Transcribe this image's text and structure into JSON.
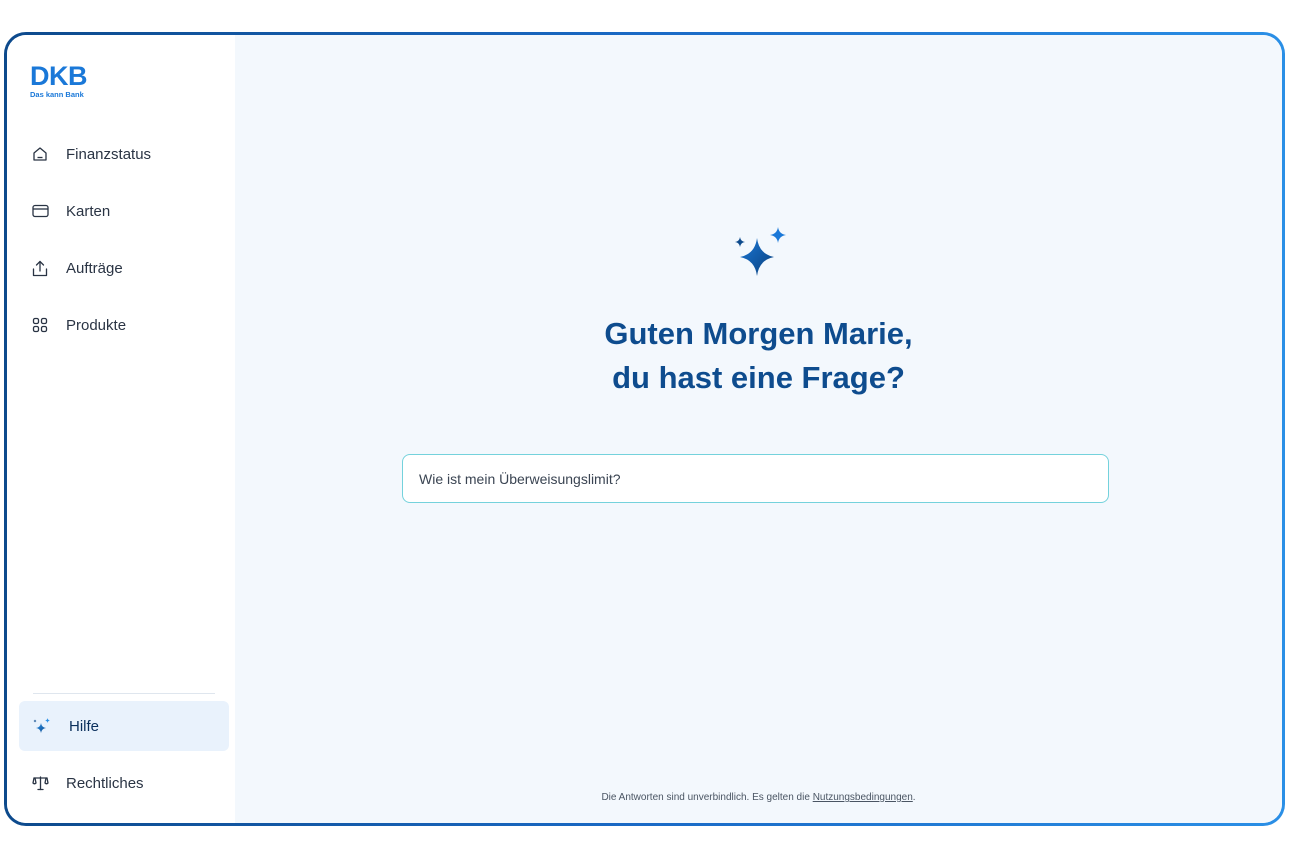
{
  "brand": {
    "name": "DKB",
    "tagline": "Das kann Bank",
    "color": "#1a78d8"
  },
  "sidebar": {
    "items": [
      {
        "label": "Finanzstatus",
        "icon": "home-icon"
      },
      {
        "label": "Karten",
        "icon": "card-icon"
      },
      {
        "label": "Aufträge",
        "icon": "upload-icon"
      },
      {
        "label": "Produkte",
        "icon": "grid-icon"
      }
    ],
    "help": {
      "label": "Hilfe",
      "icon": "sparkle-icon",
      "active": true
    },
    "legal": {
      "label": "Rechtliches",
      "icon": "scales-icon"
    }
  },
  "main": {
    "greeting_line1": "Guten Morgen Marie,",
    "greeting_line2": "du hast eine Frage?",
    "search": {
      "placeholder": "Wie ist mein Überweisungslimit?"
    },
    "footer": {
      "text": "Die Antworten sind unverbindlich. Es gelten die ",
      "link": "Nutzungsbedingungen",
      "suffix": "."
    }
  },
  "colors": {
    "accent": "#1a78d8",
    "heading": "#0e4c8e",
    "active_bg": "#e9f2fc",
    "main_bg": "#f3f8fd",
    "input_border": "#74d2dc"
  }
}
